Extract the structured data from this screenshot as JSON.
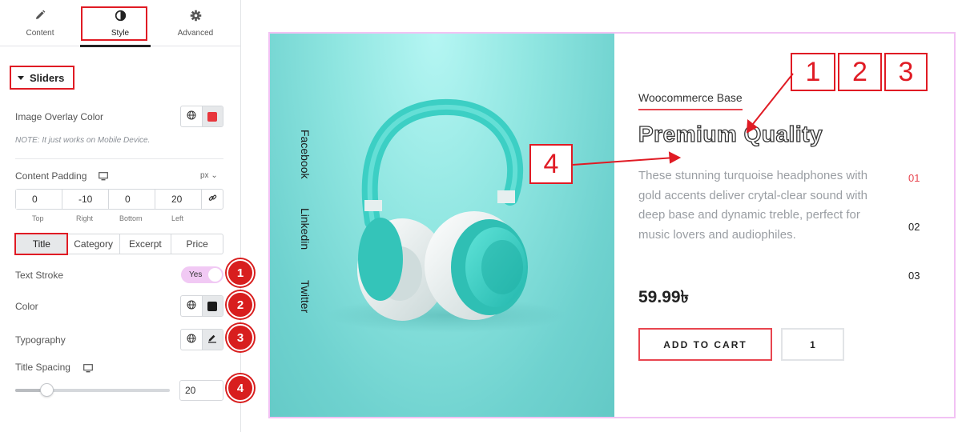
{
  "sidebar": {
    "tabs": [
      {
        "label": "Content",
        "icon": "pencil-icon"
      },
      {
        "label": "Style",
        "icon": "half-circle-icon"
      },
      {
        "label": "Advanced",
        "icon": "gear-icon"
      }
    ],
    "section_title": "Sliders",
    "image_overlay_label": "Image Overlay Color",
    "image_overlay_color": "#e8363c",
    "note": "NOTE: It just works on Mobile Device.",
    "content_padding_label": "Content Padding",
    "unit": "px",
    "padding": {
      "top": "0",
      "right": "-10",
      "bottom": "0",
      "left": "20"
    },
    "padding_labels": {
      "top": "Top",
      "right": "Right",
      "bottom": "Bottom",
      "left": "Left"
    },
    "segments": [
      "Title",
      "Category",
      "Excerpt",
      "Price"
    ],
    "text_stroke_label": "Text Stroke",
    "text_stroke_value": "Yes",
    "color_label": "Color",
    "color_value": "#1a1a1a",
    "typography_label": "Typography",
    "title_spacing_label": "Title Spacing",
    "title_spacing_value": "20",
    "title_spacing_fraction": 0.2,
    "badges": [
      "1",
      "2",
      "3",
      "4"
    ]
  },
  "preview": {
    "social": [
      "Facebook",
      "Linkedin",
      "Twitter"
    ],
    "category": "Woocommerce Base",
    "title": "Premium Quality",
    "description": "These stunning turquoise headphones with gold accents deliver crytal-clear sound with deep base and dynamic treble, perfect for music lovers and audiophiles.",
    "slide_numbers": [
      "01",
      "02",
      "03"
    ],
    "active_slide_color": "#e8454f",
    "price": "59.99৳",
    "add_to_cart": "ADD TO CART",
    "quantity": "1"
  },
  "callouts": [
    "1",
    "2",
    "3",
    "4"
  ],
  "colors": {
    "annotation": "#e01b24",
    "accent": "#e8454f",
    "toggle": "#f1c9f4"
  }
}
